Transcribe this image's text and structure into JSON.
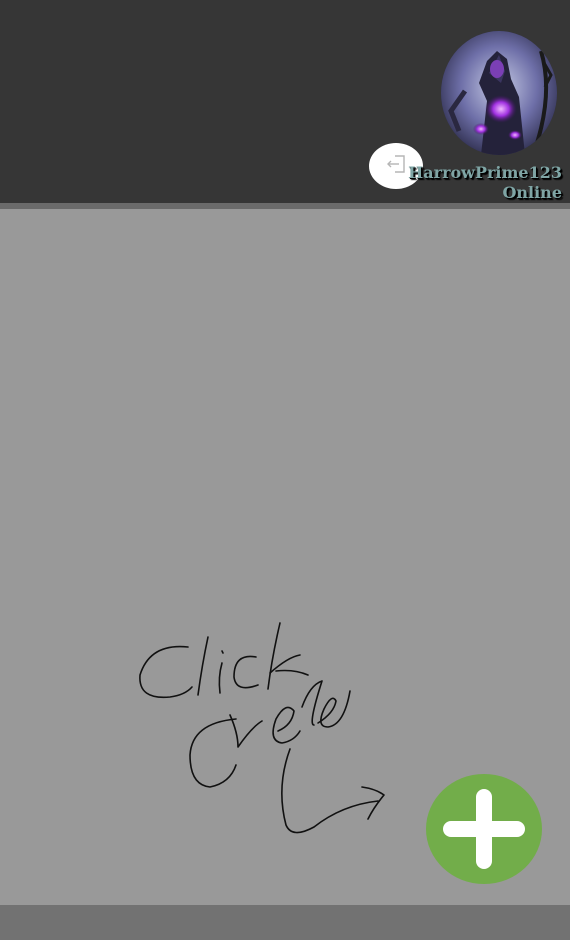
{
  "user": {
    "username": "HarrowPrime123",
    "status": "Online"
  },
  "icons": {
    "avatar": "user-avatar-image",
    "logout": "logout-icon",
    "add": "plus-icon",
    "hint": "handwritten-hint-arrow"
  },
  "hint_text": "Click here",
  "colors": {
    "header": "#363636",
    "main": "#999999",
    "footer": "#727272",
    "add_button": "#72ad4a",
    "status_text": "#7fa5a5"
  }
}
